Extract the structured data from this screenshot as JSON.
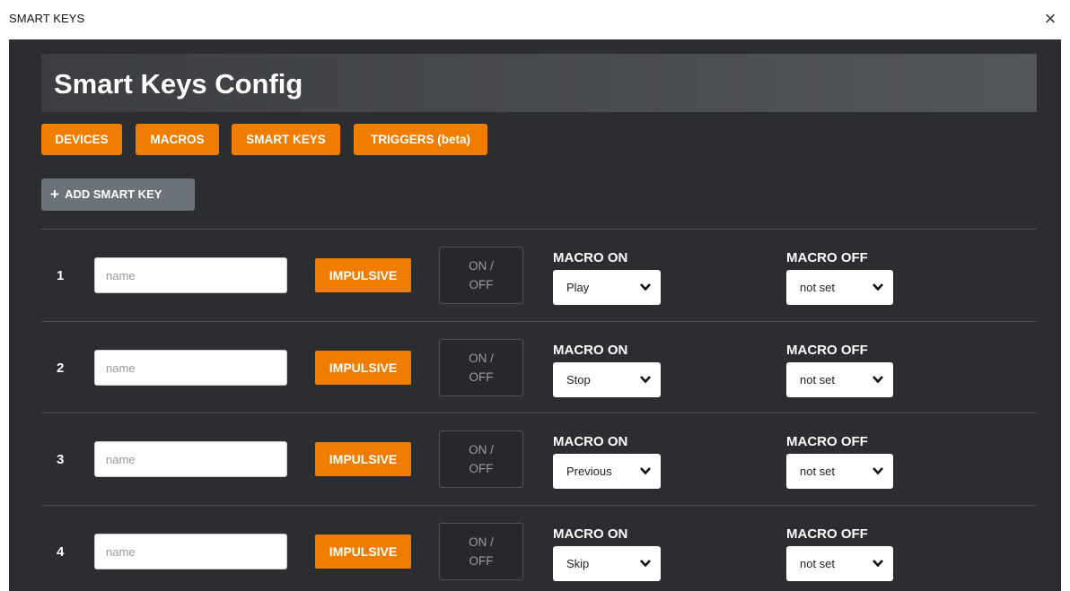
{
  "window": {
    "title": "SMART KEYS",
    "close_icon": "×"
  },
  "header": {
    "title": "Smart Keys Config"
  },
  "nav": [
    {
      "label": "DEVICES"
    },
    {
      "label": "MACROS"
    },
    {
      "label": "SMART KEYS"
    },
    {
      "label": "TRIGGERS (beta)"
    }
  ],
  "add_button": {
    "icon": "+",
    "label": "ADD SMART KEY"
  },
  "rows": [
    {
      "number": "1",
      "name_placeholder": "name",
      "mode": "IMPULSIVE",
      "toggle_line1": "ON /",
      "toggle_line2": "OFF",
      "macro_on_label": "MACRO ON",
      "macro_on": "Play",
      "macro_off_label": "MACRO OFF",
      "macro_off": "not set"
    },
    {
      "number": "2",
      "name_placeholder": "name",
      "mode": "IMPULSIVE",
      "toggle_line1": "ON /",
      "toggle_line2": "OFF",
      "macro_on_label": "MACRO ON",
      "macro_on": "Stop",
      "macro_off_label": "MACRO OFF",
      "macro_off": "not set"
    },
    {
      "number": "3",
      "name_placeholder": "name",
      "mode": "IMPULSIVE",
      "toggle_line1": "ON /",
      "toggle_line2": "OFF",
      "macro_on_label": "MACRO ON",
      "macro_on": "Previous",
      "macro_off_label": "MACRO OFF",
      "macro_off": "not set"
    },
    {
      "number": "4",
      "name_placeholder": "name",
      "mode": "IMPULSIVE",
      "toggle_line1": "ON /",
      "toggle_line2": "OFF",
      "macro_on_label": "MACRO ON",
      "macro_on": "Skip",
      "macro_off_label": "MACRO OFF",
      "macro_off": "not set"
    }
  ],
  "colors": {
    "accent": "#f07d00",
    "panel": "#2b2d30",
    "add_button": "#6c7378"
  }
}
